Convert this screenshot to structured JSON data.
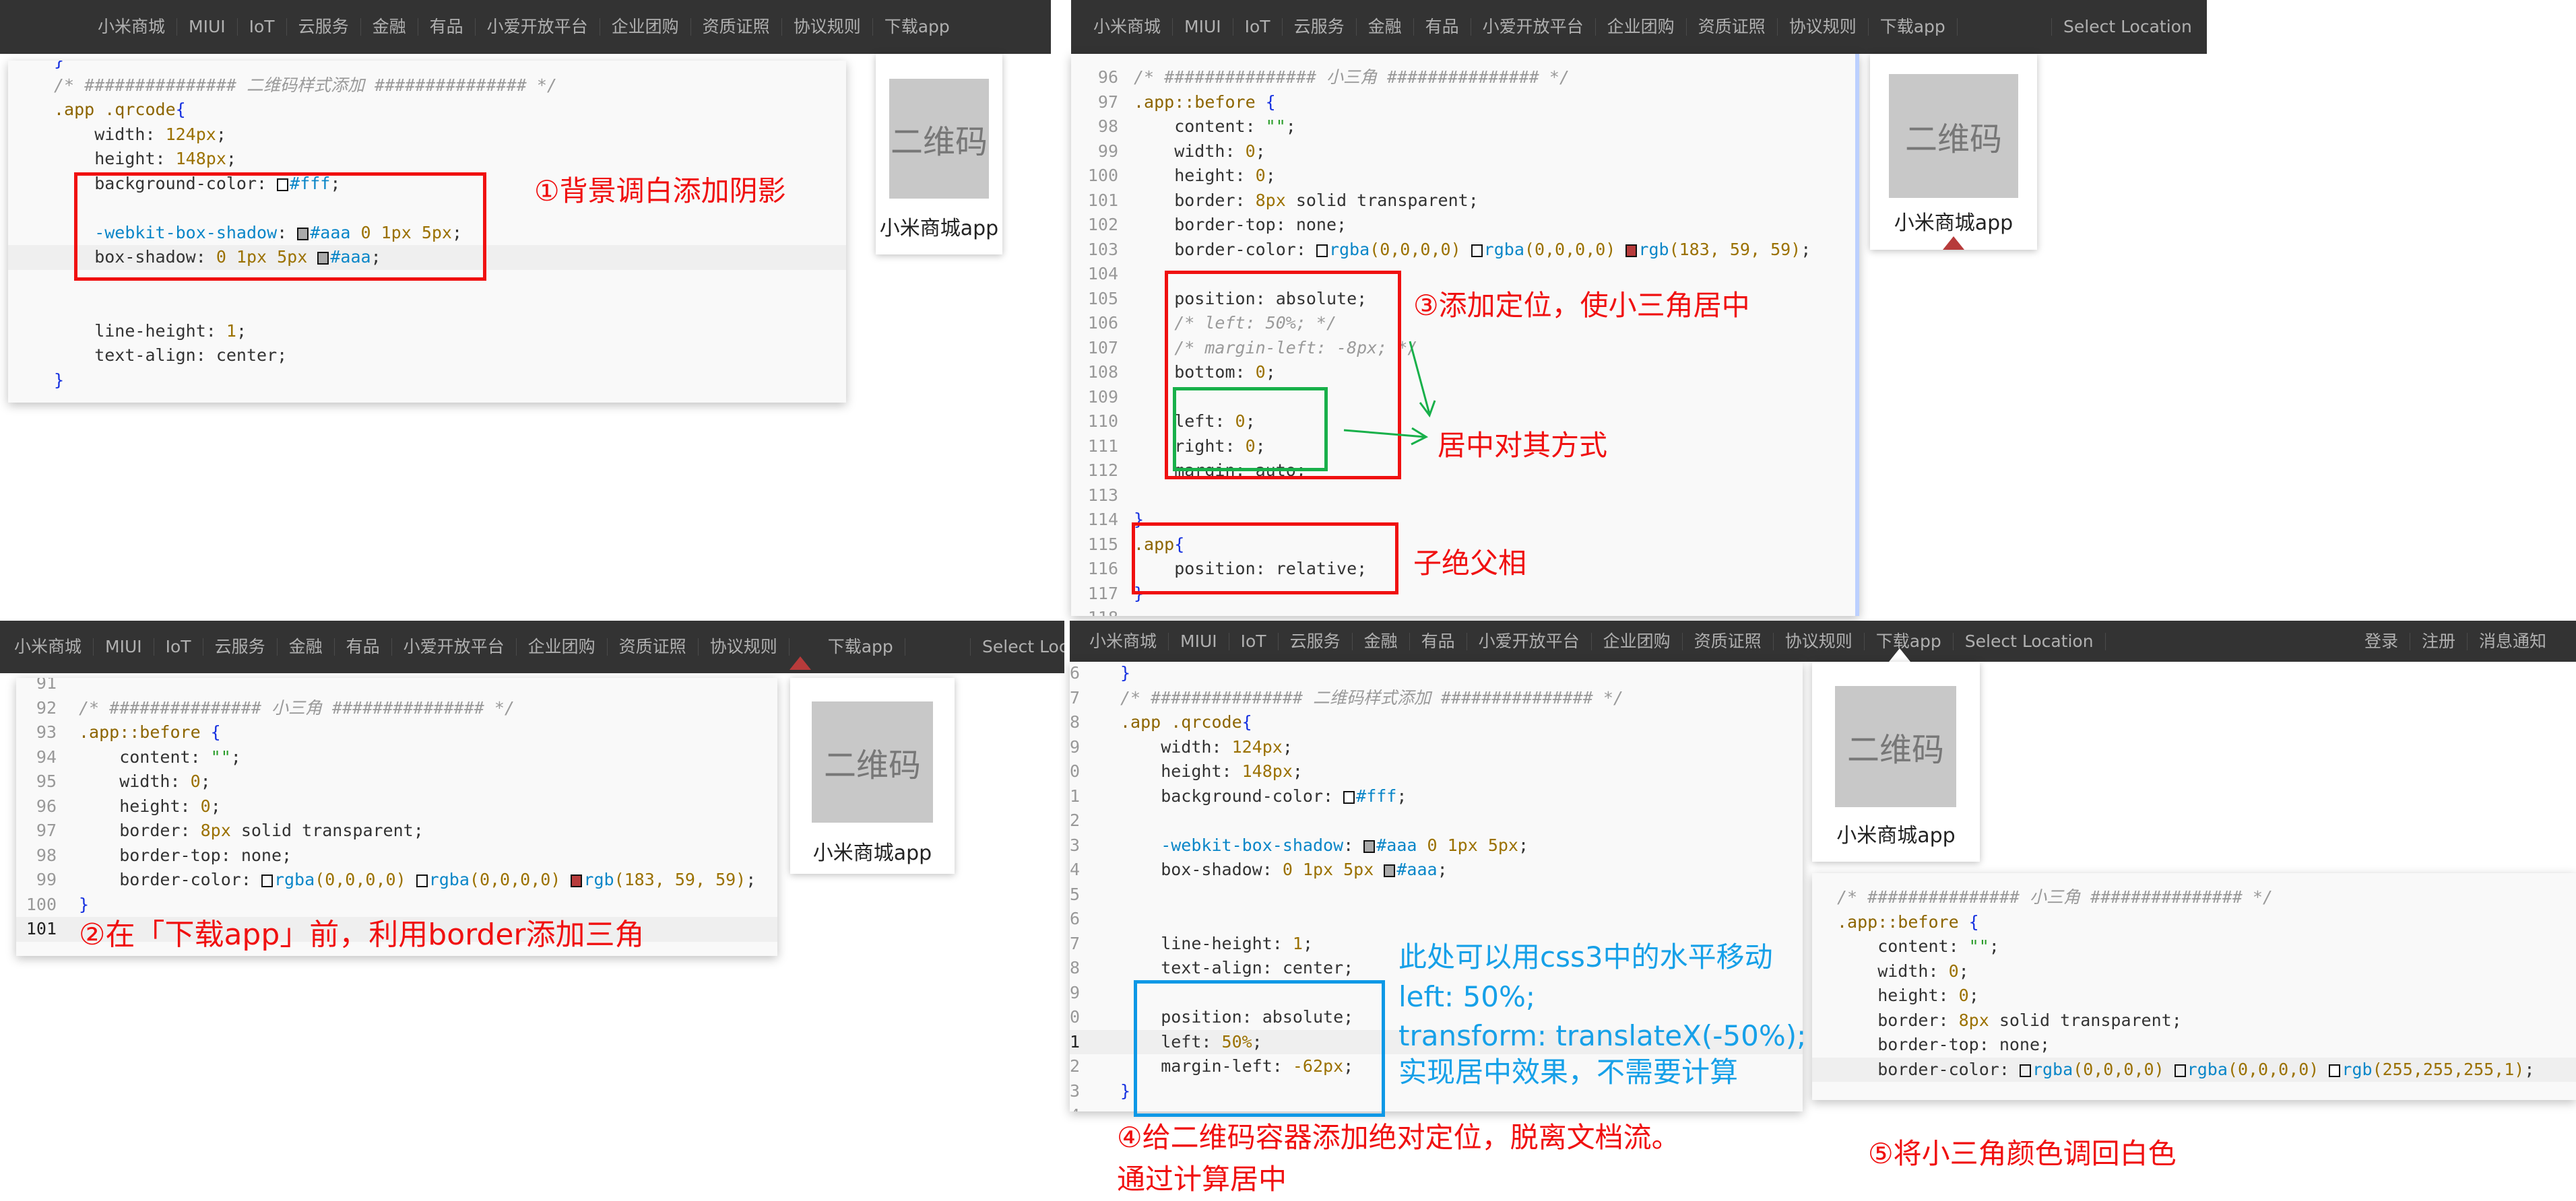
{
  "nav": {
    "items": [
      "小米商城",
      "MIUI",
      "IoT",
      "云服务",
      "金融",
      "有品",
      "小爱开放平台",
      "企业团购",
      "资质证照",
      "协议规则",
      "下载app"
    ],
    "location": "Select Location",
    "right_items": [
      "登录",
      "注册",
      "消息通知"
    ]
  },
  "qr_card": {
    "qr_text": "二维码",
    "label": "小米商城app"
  },
  "colors": {
    "nav_bg": "#333333",
    "triangle": "rgb(183, 59, 59)",
    "annotation_red": "#f01010",
    "annotation_blue": "#16a0e8",
    "annotation_green": "#18b04a"
  },
  "panels": [
    {
      "lines": [
        {
          "n": "",
          "t": [
            [
              "b",
              "}"
            ]
          ]
        },
        {
          "n": "",
          "t": [
            [
              "c",
              "/* ############### 二维码样式添加 ############### */"
            ]
          ]
        },
        {
          "n": "",
          "t": [
            [
              "sel",
              ".app .qrcode"
            ],
            [
              "b",
              "{"
            ]
          ]
        },
        {
          "n": "",
          "t": [
            [
              "p",
              "    width: "
            ],
            [
              "n",
              "124px"
            ],
            [
              "p",
              ";"
            ]
          ]
        },
        {
          "n": "",
          "t": [
            [
              "p",
              "    height: "
            ],
            [
              "n",
              "148px"
            ],
            [
              "p",
              ";"
            ]
          ]
        },
        {
          "n": "",
          "t": [
            [
              "p",
              "    background-color: "
            ],
            [
              "sw",
              "#fff"
            ],
            [
              "f",
              "#fff"
            ],
            [
              "p",
              ";"
            ]
          ]
        },
        {
          "n": "",
          "t": []
        },
        {
          "n": "",
          "t": [
            [
              "wk",
              "    -webkit-box-shadow"
            ],
            [
              "p",
              ": "
            ],
            [
              "sw",
              "#aaa"
            ],
            [
              "f",
              "#aaa"
            ],
            [
              "n",
              " 0 1px 5px"
            ],
            [
              "p",
              ";"
            ]
          ]
        },
        {
          "n": "",
          "hl": true,
          "t": [
            [
              "p",
              "    box-shadow: "
            ],
            [
              "n",
              "0 1px 5px "
            ],
            [
              "sw",
              "#aaa"
            ],
            [
              "f",
              "#aaa"
            ],
            [
              "p",
              ";"
            ]
          ]
        },
        {
          "n": "",
          "t": []
        },
        {
          "n": "",
          "t": []
        },
        {
          "n": "",
          "t": [
            [
              "p",
              "    line-height: "
            ],
            [
              "n",
              "1"
            ],
            [
              "p",
              ";"
            ]
          ]
        },
        {
          "n": "",
          "t": [
            [
              "p",
              "    text-align: center;"
            ]
          ]
        },
        {
          "n": "",
          "t": [
            [
              "b",
              "}"
            ]
          ]
        }
      ]
    },
    {
      "lines": [
        {
          "n": "96",
          "t": [
            [
              "c",
              "/* ############### 小三角 ############### */"
            ]
          ]
        },
        {
          "n": "97",
          "t": [
            [
              "sel",
              ".app::before "
            ],
            [
              "b",
              "{"
            ]
          ]
        },
        {
          "n": "98",
          "t": [
            [
              "p",
              "    content: "
            ],
            [
              "s",
              "\"\""
            ],
            [
              "p",
              ";"
            ]
          ]
        },
        {
          "n": "99",
          "t": [
            [
              "p",
              "    width: "
            ],
            [
              "n",
              "0"
            ],
            [
              "p",
              ";"
            ]
          ]
        },
        {
          "n": "100",
          "t": [
            [
              "p",
              "    height: "
            ],
            [
              "n",
              "0"
            ],
            [
              "p",
              ";"
            ]
          ]
        },
        {
          "n": "101",
          "t": [
            [
              "p",
              "    border: "
            ],
            [
              "n",
              "8px"
            ],
            [
              "p",
              " solid transparent;"
            ]
          ]
        },
        {
          "n": "102",
          "t": [
            [
              "p",
              "    border-top: none;"
            ]
          ]
        },
        {
          "n": "103",
          "t": [
            [
              "p",
              "    border-color: "
            ],
            [
              "sw",
              "rgba(0,0,0,0)"
            ],
            [
              "f",
              "rgba"
            ],
            [
              "n",
              "(0,0,0,0) "
            ],
            [
              "sw",
              "rgba(0,0,0,0)"
            ],
            [
              "f",
              "rgba"
            ],
            [
              "n",
              "(0,0,0,0) "
            ],
            [
              "sw",
              "rgb(183,59,59)"
            ],
            [
              "f",
              "rgb"
            ],
            [
              "n",
              "(183, 59, 59)"
            ],
            [
              "p",
              ";"
            ]
          ]
        },
        {
          "n": "104",
          "t": []
        },
        {
          "n": "105",
          "t": [
            [
              "p",
              "    position: absolute;"
            ]
          ]
        },
        {
          "n": "106",
          "t": [
            [
              "c",
              "    /* left: 50%; */"
            ]
          ]
        },
        {
          "n": "107",
          "t": [
            [
              "c",
              "    /* margin-left: -8px; */"
            ]
          ]
        },
        {
          "n": "108",
          "t": [
            [
              "p",
              "    bottom: "
            ],
            [
              "n",
              "0"
            ],
            [
              "p",
              ";"
            ]
          ]
        },
        {
          "n": "109",
          "t": []
        },
        {
          "n": "110",
          "t": [
            [
              "p",
              "    left: "
            ],
            [
              "n",
              "0"
            ],
            [
              "p",
              ";"
            ]
          ]
        },
        {
          "n": "111",
          "t": [
            [
              "p",
              "    right: "
            ],
            [
              "n",
              "0"
            ],
            [
              "p",
              ";"
            ]
          ]
        },
        {
          "n": "112",
          "t": [
            [
              "p",
              "    margin: auto;"
            ]
          ]
        },
        {
          "n": "113",
          "t": []
        },
        {
          "n": "114",
          "t": [
            [
              "b",
              "}"
            ]
          ]
        },
        {
          "n": "115",
          "t": [
            [
              "sel",
              ".app"
            ],
            [
              "b",
              "{"
            ]
          ]
        },
        {
          "n": "116",
          "t": [
            [
              "p",
              "    position: relative;"
            ]
          ]
        },
        {
          "n": "117",
          "t": [
            [
              "b",
              "}"
            ]
          ]
        },
        {
          "n": "118",
          "t": []
        }
      ]
    },
    {
      "lines": [
        {
          "n": "91",
          "t": []
        },
        {
          "n": "92",
          "t": [
            [
              "c",
              "/* ############### 小三角 ############### */"
            ]
          ]
        },
        {
          "n": "93",
          "t": [
            [
              "sel",
              ".app::before "
            ],
            [
              "b",
              "{"
            ]
          ]
        },
        {
          "n": "94",
          "t": [
            [
              "p",
              "    content: "
            ],
            [
              "s",
              "\"\""
            ],
            [
              "p",
              ";"
            ]
          ]
        },
        {
          "n": "95",
          "t": [
            [
              "p",
              "    width: "
            ],
            [
              "n",
              "0"
            ],
            [
              "p",
              ";"
            ]
          ]
        },
        {
          "n": "96",
          "t": [
            [
              "p",
              "    height: "
            ],
            [
              "n",
              "0"
            ],
            [
              "p",
              ";"
            ]
          ]
        },
        {
          "n": "97",
          "t": [
            [
              "p",
              "    border: "
            ],
            [
              "n",
              "8px"
            ],
            [
              "p",
              " solid transparent;"
            ]
          ]
        },
        {
          "n": "98",
          "t": [
            [
              "p",
              "    border-top: none;"
            ]
          ]
        },
        {
          "n": "99",
          "t": [
            [
              "p",
              "    border-color: "
            ],
            [
              "sw",
              "rgba(0,0,0,0)"
            ],
            [
              "f",
              "rgba"
            ],
            [
              "n",
              "(0,0,0,0) "
            ],
            [
              "sw",
              "rgba(0,0,0,0)"
            ],
            [
              "f",
              "rgba"
            ],
            [
              "n",
              "(0,0,0,0) "
            ],
            [
              "sw",
              "rgb(183,59,59)"
            ],
            [
              "f",
              "rgb"
            ],
            [
              "n",
              "(183, 59, 59)"
            ],
            [
              "p",
              ";"
            ]
          ]
        },
        {
          "n": "100",
          "t": [
            [
              "b",
              "}"
            ]
          ]
        },
        {
          "n": "101",
          "hl": true,
          "t": []
        }
      ]
    },
    {
      "lines": [
        {
          "n": "6",
          "t": [
            [
              "b",
              "}"
            ]
          ]
        },
        {
          "n": "7",
          "t": [
            [
              "c",
              "/* ############### 二维码样式添加 ############### */"
            ]
          ]
        },
        {
          "n": "8",
          "t": [
            [
              "sel",
              ".app .qrcode"
            ],
            [
              "b",
              "{"
            ]
          ]
        },
        {
          "n": "9",
          "t": [
            [
              "p",
              "    width: "
            ],
            [
              "n",
              "124px"
            ],
            [
              "p",
              ";"
            ]
          ]
        },
        {
          "n": "0",
          "t": [
            [
              "p",
              "    height: "
            ],
            [
              "n",
              "148px"
            ],
            [
              "p",
              ";"
            ]
          ]
        },
        {
          "n": "1",
          "t": [
            [
              "p",
              "    background-color: "
            ],
            [
              "sw",
              "#fff"
            ],
            [
              "f",
              "#fff"
            ],
            [
              "p",
              ";"
            ]
          ]
        },
        {
          "n": "2",
          "t": []
        },
        {
          "n": "3",
          "t": [
            [
              "wk",
              "    -webkit-box-shadow"
            ],
            [
              "p",
              ": "
            ],
            [
              "sw",
              "#aaa"
            ],
            [
              "f",
              "#aaa"
            ],
            [
              "n",
              " 0 1px 5px"
            ],
            [
              "p",
              ";"
            ]
          ]
        },
        {
          "n": "4",
          "t": [
            [
              "p",
              "    box-shadow: "
            ],
            [
              "n",
              "0 1px 5px "
            ],
            [
              "sw",
              "#aaa"
            ],
            [
              "f",
              "#aaa"
            ],
            [
              "p",
              ";"
            ]
          ]
        },
        {
          "n": "5",
          "t": []
        },
        {
          "n": "6",
          "t": []
        },
        {
          "n": "7",
          "t": [
            [
              "p",
              "    line-height: "
            ],
            [
              "n",
              "1"
            ],
            [
              "p",
              ";"
            ]
          ]
        },
        {
          "n": "8",
          "t": [
            [
              "p",
              "    text-align: center;"
            ]
          ]
        },
        {
          "n": "9",
          "t": []
        },
        {
          "n": "0",
          "t": [
            [
              "p",
              "    position: absolute;"
            ]
          ]
        },
        {
          "n": "1",
          "hl": true,
          "t": [
            [
              "p",
              "    left: "
            ],
            [
              "n",
              "50%"
            ],
            [
              "p",
              ";"
            ]
          ]
        },
        {
          "n": "2",
          "t": [
            [
              "p",
              "    margin-left: "
            ],
            [
              "n",
              "-62px"
            ],
            [
              "p",
              ";"
            ]
          ]
        },
        {
          "n": "3",
          "t": [
            [
              "b",
              "}"
            ]
          ]
        },
        {
          "n": "4",
          "t": []
        }
      ]
    },
    {
      "lines": [
        {
          "n": "",
          "t": [
            [
              "c",
              "/* ############### 小三角 ############### */"
            ]
          ]
        },
        {
          "n": "",
          "t": [
            [
              "sel",
              ".app::before "
            ],
            [
              "b",
              "{"
            ]
          ]
        },
        {
          "n": "",
          "t": [
            [
              "p",
              "    content: "
            ],
            [
              "s",
              "\"\""
            ],
            [
              "p",
              ";"
            ]
          ]
        },
        {
          "n": "",
          "t": [
            [
              "p",
              "    width: "
            ],
            [
              "n",
              "0"
            ],
            [
              "p",
              ";"
            ]
          ]
        },
        {
          "n": "",
          "t": [
            [
              "p",
              "    height: "
            ],
            [
              "n",
              "0"
            ],
            [
              "p",
              ";"
            ]
          ]
        },
        {
          "n": "",
          "t": [
            [
              "p",
              "    border: "
            ],
            [
              "n",
              "8px"
            ],
            [
              "p",
              " solid transparent;"
            ]
          ]
        },
        {
          "n": "",
          "t": [
            [
              "p",
              "    border-top: none;"
            ]
          ]
        },
        {
          "n": "",
          "hl": true,
          "t": [
            [
              "p",
              "    border-color: "
            ],
            [
              "sw",
              "rgba(0,0,0,0)"
            ],
            [
              "f",
              "rgba"
            ],
            [
              "n",
              "(0,0,0,0) "
            ],
            [
              "sw",
              "rgba(0,0,0,0)"
            ],
            [
              "f",
              "rgba"
            ],
            [
              "n",
              "(0,0,0,0) "
            ],
            [
              "sw",
              "rgb(255,255,255)"
            ],
            [
              "f",
              "rgb"
            ],
            [
              "n",
              "(255,255,255,1)"
            ],
            [
              "p",
              ";"
            ]
          ]
        },
        {
          "n": "",
          "t": []
        }
      ]
    }
  ],
  "annotations": {
    "step1": "①背景调白添加阴影",
    "step2": "②在「下载app」前，利用border添加三角",
    "step3": "③添加定位，使小三角居中",
    "step3_center": "居中对其方式",
    "step3_parent": "子绝父相",
    "tip_lines": [
      "此处可以用css3中的水平移动",
      "left: 50%;",
      "transform: translateX(-50%);",
      "实现居中效果，不需要计算"
    ],
    "step4_line1": "④给二维码容器添加绝对定位，脱离文档流。",
    "step4_line2": "通过计算居中",
    "step5": "⑤将小三角颜色调回白色"
  }
}
